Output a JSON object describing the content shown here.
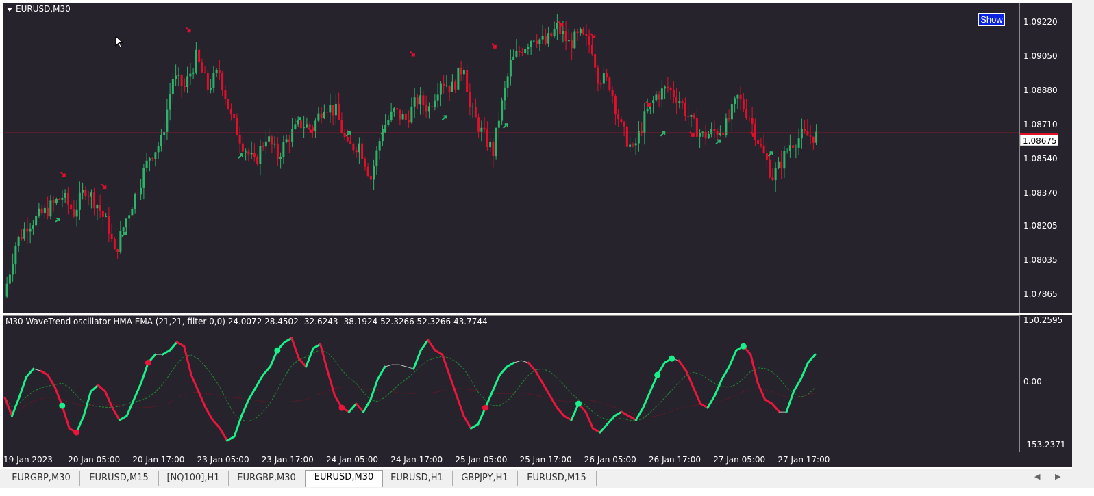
{
  "chart_title": "EURUSD,M30",
  "show_button": "Show",
  "current_price": "1.08675",
  "price_axis": [
    "1.09220",
    "1.09050",
    "1.08880",
    "1.08710",
    "1.08540",
    "1.08370",
    "1.08205",
    "1.08035",
    "1.07865"
  ],
  "osc_title": "M30 WaveTrend oscillator  HMA EMA (21,21, filter 0,0) 24.0072 28.4502 -32.6243 -38.1924 52.3266 52.3266 43.7744",
  "osc_axis": [
    "150.2595",
    "0.00",
    "-153.2371"
  ],
  "time_axis": [
    "19 Jan 2023",
    "20 Jan 05:00",
    "20 Jan 17:00",
    "23 Jan 05:00",
    "23 Jan 17:00",
    "24 Jan 05:00",
    "24 Jan 17:00",
    "25 Jan 05:00",
    "25 Jan 17:00",
    "26 Jan 05:00",
    "26 Jan 17:00",
    "27 Jan 05:00",
    "27 Jan 17:00"
  ],
  "tabs": [
    "EURGBP,M30",
    "EURUSD,M15",
    "[NQ100],H1",
    "EURGBP,M30",
    "EURUSD,M30",
    "EURUSD,H1",
    "GBPJPY,H1",
    "EURUSD,M15"
  ],
  "active_tab": 4,
  "colors": {
    "background": "#26232d",
    "bull": "#2fb36a",
    "bear": "#e0102b",
    "osc_up": "#19f08a",
    "osc_down": "#e8163d",
    "price_line": "#e0102b"
  },
  "chart_data": [
    {
      "type": "candlestick",
      "title": "EURUSD,M30",
      "ylim": [
        1.0778,
        1.0932
      ],
      "price_line": 1.08675,
      "path_keypoints": [
        [
          0,
          1.0786
        ],
        [
          4,
          1.0812
        ],
        [
          8,
          1.0822
        ],
        [
          14,
          1.0828
        ],
        [
          20,
          1.0836
        ],
        [
          24,
          1.0828
        ],
        [
          28,
          1.084
        ],
        [
          32,
          1.0832
        ],
        [
          36,
          1.082
        ],
        [
          38,
          1.0807
        ],
        [
          42,
          1.0825
        ],
        [
          46,
          1.084
        ],
        [
          50,
          1.0856
        ],
        [
          54,
          1.0863
        ],
        [
          58,
          1.0895
        ],
        [
          62,
          1.089
        ],
        [
          66,
          1.0905
        ],
        [
          70,
          1.089
        ],
        [
          74,
          1.0898
        ],
        [
          78,
          1.0875
        ],
        [
          82,
          1.0862
        ],
        [
          86,
          1.0852
        ],
        [
          90,
          1.0866
        ],
        [
          94,
          1.0856
        ],
        [
          98,
          1.0866
        ],
        [
          102,
          1.0872
        ],
        [
          106,
          1.087
        ],
        [
          110,
          1.0882
        ],
        [
          114,
          1.0878
        ],
        [
          118,
          1.086
        ],
        [
          122,
          1.0862
        ],
        [
          126,
          1.0845
        ],
        [
          130,
          1.087
        ],
        [
          134,
          1.0878
        ],
        [
          138,
          1.0874
        ],
        [
          142,
          1.0884
        ],
        [
          146,
          1.088
        ],
        [
          150,
          1.0894
        ],
        [
          154,
          1.089
        ],
        [
          158,
          1.0902
        ],
        [
          160,
          1.088
        ],
        [
          164,
          1.0868
        ],
        [
          168,
          1.0858
        ],
        [
          170,
          1.0875
        ],
        [
          174,
          1.0902
        ],
        [
          178,
          1.091
        ],
        [
          182,
          1.0916
        ],
        [
          186,
          1.0912
        ],
        [
          190,
          1.092
        ],
        [
          194,
          1.0912
        ],
        [
          198,
          1.0916
        ],
        [
          202,
          1.091
        ],
        [
          204,
          1.0896
        ],
        [
          208,
          1.0892
        ],
        [
          212,
          1.087
        ],
        [
          216,
          1.0858
        ],
        [
          220,
          1.0875
        ],
        [
          224,
          1.0886
        ],
        [
          228,
          1.089
        ],
        [
          232,
          1.0884
        ],
        [
          236,
          1.0873
        ],
        [
          240,
          1.0866
        ],
        [
          244,
          1.0868
        ],
        [
          248,
          1.0871
        ],
        [
          252,
          1.0885
        ],
        [
          256,
          1.0876
        ],
        [
          260,
          1.086
        ],
        [
          264,
          1.0846
        ],
        [
          266,
          1.085
        ],
        [
          270,
          1.0862
        ],
        [
          274,
          1.0866
        ],
        [
          278,
          1.0866
        ]
      ],
      "candles_count": 279,
      "buy_arrows": [
        [
          17,
          1.0825
        ],
        [
          40,
          1.0818
        ],
        [
          80,
          1.0857
        ],
        [
          100,
          1.0875
        ],
        [
          117,
          1.0868
        ],
        [
          129,
          1.0869
        ],
        [
          150,
          1.0876
        ],
        [
          171,
          1.0872
        ],
        [
          225,
          1.0868
        ],
        [
          244,
          1.0864
        ],
        [
          262,
          1.0858
        ]
      ],
      "sell_arrows": [
        [
          19,
          1.0848
        ],
        [
          33,
          1.0842
        ],
        [
          62,
          1.092
        ],
        [
          104,
          1.087
        ],
        [
          139,
          1.0908
        ],
        [
          167,
          1.0912
        ],
        [
          190,
          1.0923
        ],
        [
          201,
          1.0917
        ],
        [
          220,
          1.0883
        ],
        [
          235,
          1.0868
        ],
        [
          256,
          1.0868
        ]
      ]
    },
    {
      "type": "line",
      "title": "M30 WaveTrend oscillator",
      "ylim": [
        -153.2371,
        150.2595
      ],
      "series": [
        {
          "role": "main",
          "values": [
            -35,
            -80,
            -35,
            15,
            35,
            30,
            20,
            -10,
            -55,
            -110,
            -120,
            -80,
            -20,
            -5,
            -20,
            -60,
            -90,
            -80,
            -40,
            0,
            50,
            70,
            70,
            80,
            100,
            90,
            20,
            -20,
            -60,
            -90,
            -110,
            -140,
            -130,
            -80,
            -40,
            -10,
            20,
            40,
            80,
            100,
            110,
            60,
            40,
            85,
            95,
            30,
            -30,
            -60,
            -70,
            -50,
            -70,
            -40,
            10,
            40,
            45,
            45,
            40,
            35,
            80,
            105,
            80,
            70,
            20,
            -30,
            -80,
            -110,
            -100,
            -60,
            -20,
            20,
            40,
            50,
            55,
            50,
            30,
            0,
            -30,
            -60,
            -80,
            -90,
            -50,
            -70,
            -110,
            -120,
            -100,
            -80,
            -70,
            -80,
            -90,
            -60,
            -20,
            20,
            50,
            60,
            55,
            30,
            -10,
            -50,
            -60,
            -30,
            10,
            40,
            80,
            90,
            70,
            0,
            -40,
            -50,
            -70,
            -70,
            -20,
            10,
            50,
            70
          ]
        }
      ],
      "up_signals": [
        8,
        38,
        80,
        91,
        93,
        103,
        121,
        160,
        182,
        206,
        214,
        228
      ],
      "down_signals": [
        10,
        20,
        47,
        67,
        119,
        132,
        154,
        177,
        219,
        240,
        251,
        264
      ]
    }
  ]
}
